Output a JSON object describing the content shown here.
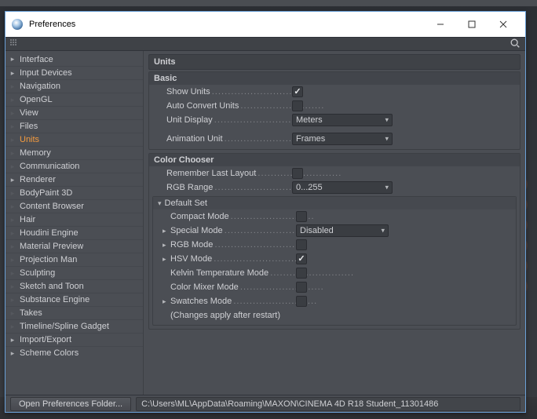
{
  "window": {
    "title": "Preferences"
  },
  "sidebar": {
    "items": [
      {
        "label": "Interface",
        "expandable": true
      },
      {
        "label": "Input Devices",
        "expandable": true
      },
      {
        "label": "Navigation",
        "expandable": false
      },
      {
        "label": "OpenGL",
        "expandable": false
      },
      {
        "label": "View",
        "expandable": false
      },
      {
        "label": "Files",
        "expandable": false
      },
      {
        "label": "Units",
        "expandable": false,
        "active": true
      },
      {
        "label": "Memory",
        "expandable": false
      },
      {
        "label": "Communication",
        "expandable": false
      },
      {
        "label": "Renderer",
        "expandable": true
      },
      {
        "label": "BodyPaint 3D",
        "expandable": false
      },
      {
        "label": "Content Browser",
        "expandable": false
      },
      {
        "label": "Hair",
        "expandable": false
      },
      {
        "label": "Houdini Engine",
        "expandable": false
      },
      {
        "label": "Material Preview",
        "expandable": false
      },
      {
        "label": "Projection Man",
        "expandable": false
      },
      {
        "label": "Sculpting",
        "expandable": false
      },
      {
        "label": "Sketch and Toon",
        "expandable": false
      },
      {
        "label": "Substance Engine",
        "expandable": false
      },
      {
        "label": "Takes",
        "expandable": false
      },
      {
        "label": "Timeline/Spline Gadget",
        "expandable": false
      },
      {
        "label": "Import/Export",
        "expandable": true
      },
      {
        "label": "Scheme Colors",
        "expandable": true
      }
    ]
  },
  "panel": {
    "title": "Units",
    "basic": {
      "title": "Basic",
      "show_units": {
        "label": "Show Units",
        "checked": true
      },
      "auto_convert": {
        "label": "Auto Convert Units",
        "checked": false
      },
      "unit_display": {
        "label": "Unit Display",
        "value": "Meters"
      },
      "animation_unit": {
        "label": "Animation Unit",
        "value": "Frames"
      }
    },
    "color_chooser": {
      "title": "Color Chooser",
      "remember_last_layout": {
        "label": "Remember Last Layout",
        "checked": false
      },
      "rgb_range": {
        "label": "RGB Range",
        "value": "0...255"
      },
      "default_set": {
        "title": "Default Set",
        "compact_mode": {
          "label": "Compact Mode",
          "checked": false
        },
        "special_mode": {
          "label": "Special Mode",
          "value": "Disabled"
        },
        "rgb_mode": {
          "label": "RGB Mode",
          "checked": false
        },
        "hsv_mode": {
          "label": "HSV Mode",
          "checked": true
        },
        "kelvin_mode": {
          "label": "Kelvin Temperature Mode",
          "checked": false
        },
        "color_mixer_mode": {
          "label": "Color Mixer Mode",
          "checked": false
        },
        "swatches_mode": {
          "label": "Swatches Mode",
          "checked": false
        },
        "note": "(Changes apply after restart)"
      }
    }
  },
  "footer": {
    "open_button": "Open Preferences Folder...",
    "path": "C:\\Users\\ML\\AppData\\Roaming\\MAXON\\CINEMA 4D R18 Student_11301486"
  }
}
